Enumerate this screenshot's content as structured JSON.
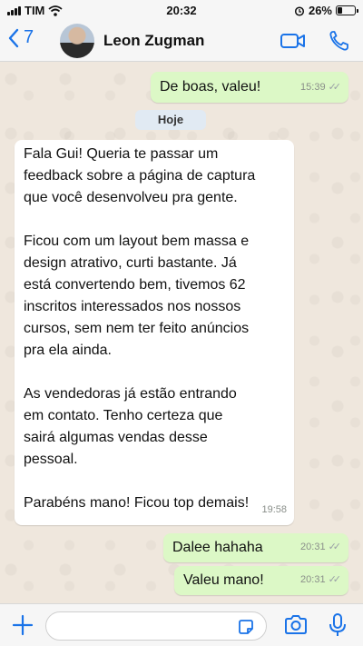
{
  "status_bar": {
    "carrier": "TIM",
    "time": "20:32",
    "battery": "26%",
    "battery_level": 0.26
  },
  "header": {
    "back_count": "7",
    "contact_name": "Leon Zugman"
  },
  "chat": {
    "date_chip": "Hoje",
    "messages": [
      {
        "direction": "out",
        "text": "De boas, valeu!",
        "time": "15:39",
        "status": "read"
      },
      {
        "direction": "in",
        "text": "Fala Gui! Queria te passar um\nfeedback sobre a página de captura\nque você desenvolveu pra gente.\n\nFicou com um layout bem massa e\ndesign atrativo, curti bastante. Já\nestá convertendo bem, tivemos 62\ninscritos interessados nos nossos\ncursos, sem nem ter feito anúncios\npra ela ainda.\n\nAs vendedoras já estão entrando\nem contato. Tenho certeza que\nsairá algumas vendas desse\npessoal.\n\nParabéns mano! Ficou top demais!",
        "time": "19:58"
      },
      {
        "direction": "out",
        "text": "Dalee hahaha",
        "time": "20:31",
        "status": "read"
      },
      {
        "direction": "out",
        "text": "Valeu mano!",
        "time": "20:31",
        "status": "read"
      }
    ]
  },
  "composer": {
    "placeholder": ""
  },
  "colors": {
    "accent": "#1a73e8",
    "out_bubble": "#dcf8c6",
    "in_bubble": "#ffffff",
    "chat_bg": "#efe7dd"
  }
}
